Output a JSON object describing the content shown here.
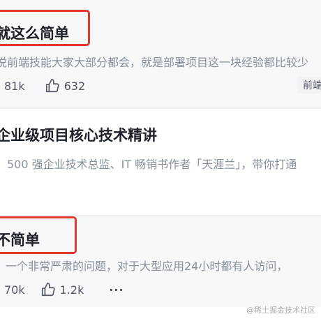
{
  "articles": [
    {
      "title": "就这么简单",
      "desc": "说前端技能大家大部分都会，就是部署项目这一块经验都比较少",
      "views": "81k",
      "likes": "632",
      "tag": "前端"
    },
    {
      "title": "企业级项目核心技术精讲",
      "desc": "500 强企业技术总监、IT 畅销书作者「天涯兰」，带你打通"
    },
    {
      "title": "不简单",
      "desc": "一个非常严肃的问题，对于大型应用24小时都有人访问，",
      "views": "70k",
      "likes": "1.2k",
      "more": "···"
    }
  ],
  "watermark": "@稀土掘金技术社区",
  "colors": {
    "highlight": "#e23b2e",
    "muted": "#86909c",
    "text": "#1d2129"
  }
}
